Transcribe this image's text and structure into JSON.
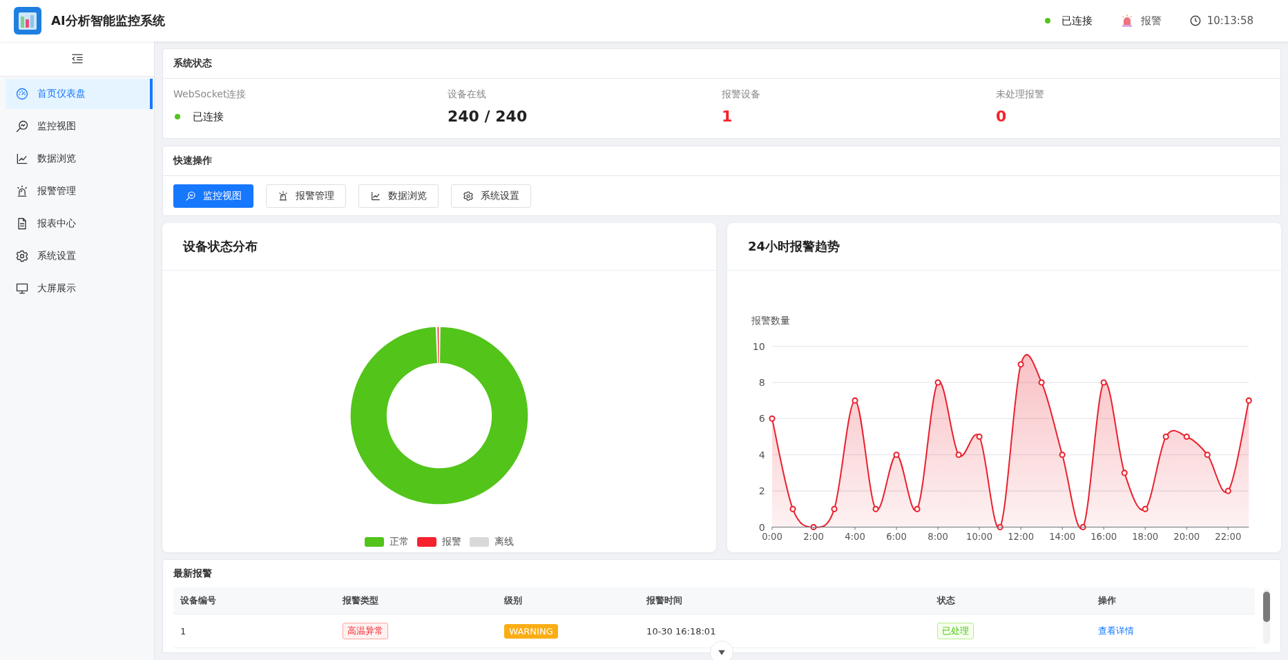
{
  "header": {
    "title": "AI分析智能监控系统",
    "connection": {
      "text": "已连接",
      "connected": true
    },
    "alarm": "报警",
    "time": "10:13:58"
  },
  "sidebar": {
    "items": [
      {
        "label": "首页仪表盘",
        "selected": true
      },
      {
        "label": "监控视图",
        "selected": false
      },
      {
        "label": "数据浏览",
        "selected": false
      },
      {
        "label": "报警管理",
        "selected": false
      },
      {
        "label": "报表中心",
        "selected": false
      },
      {
        "label": "系统设置",
        "selected": false
      },
      {
        "label": "大屏展示",
        "selected": false
      }
    ]
  },
  "system_status": {
    "title": "系统状态",
    "items": [
      {
        "kind": "connection",
        "label": "WebSocket连接",
        "value": "已连接",
        "connected": true
      },
      {
        "kind": "count",
        "label": "设备在线",
        "value": "240 / 240",
        "alert": false
      },
      {
        "kind": "count",
        "label": "报警设备",
        "value": "1",
        "alert": true
      },
      {
        "kind": "count",
        "label": "未处理报警",
        "value": "0",
        "alert": true
      }
    ]
  },
  "quick_actions": {
    "title": "快速操作",
    "buttons": [
      {
        "label": "监控视图",
        "selected": true
      },
      {
        "label": "报警管理",
        "selected": false
      },
      {
        "label": "数据浏览",
        "selected": false
      },
      {
        "label": "系统设置",
        "selected": false
      }
    ]
  },
  "device_status": {
    "title": "设备状态分布",
    "chart_data": {
      "type": "donut",
      "categories": [
        "正常",
        "报警",
        "离线"
      ],
      "values": [
        99.58,
        0.42,
        0
      ],
      "legend": "bottom",
      "colors": [
        "#52c41a",
        "#f5222d",
        "#d9d9d9"
      ]
    }
  },
  "alarm_trend": {
    "title": "24小时报警趋势",
    "chart_data": {
      "type": "area",
      "ylabel": "报警数量",
      "x": [
        0,
        1,
        2,
        3,
        4,
        5,
        6,
        7,
        8,
        9,
        10,
        11,
        12,
        13,
        14,
        15,
        16,
        17,
        18,
        19,
        20,
        21,
        22,
        23
      ],
      "xlim": [
        0,
        23
      ],
      "grid": true,
      "series": [
        {
          "color": "#e8222f",
          "values": [
            6,
            1,
            0,
            1,
            7,
            1,
            4,
            1,
            8,
            4,
            5,
            0,
            9,
            8,
            4,
            0,
            8,
            3,
            1,
            5,
            5,
            4,
            2,
            7
          ]
        }
      ],
      "ylim": [
        0,
        10
      ],
      "yticks": [
        0,
        2,
        4,
        6,
        8,
        10
      ],
      "xticks": [
        {
          "value": 0,
          "label": "0:00"
        },
        {
          "value": 2,
          "label": "2:00"
        },
        {
          "value": 4,
          "label": "4:00"
        },
        {
          "value": 6,
          "label": "6:00"
        },
        {
          "value": 8,
          "label": "8:00"
        },
        {
          "value": 10,
          "label": "10:00"
        },
        {
          "value": 12,
          "label": "12:00"
        },
        {
          "value": 14,
          "label": "14:00"
        },
        {
          "value": 16,
          "label": "16:00"
        },
        {
          "value": 18,
          "label": "18:00"
        },
        {
          "value": 20,
          "label": "20:00"
        },
        {
          "value": 22,
          "label": "22:00"
        }
      ]
    }
  },
  "latest_alarms": {
    "title": "最新报警",
    "columns": [
      "设备编号",
      "报警类型",
      "级别",
      "报警时间",
      "状态",
      "操作"
    ],
    "rows": [
      {
        "device_id": "1",
        "alarm_type": "高温异常",
        "level": "WARNING",
        "time": "10-30 16:18:01",
        "status": "已处理",
        "action": "查看详情"
      }
    ]
  }
}
